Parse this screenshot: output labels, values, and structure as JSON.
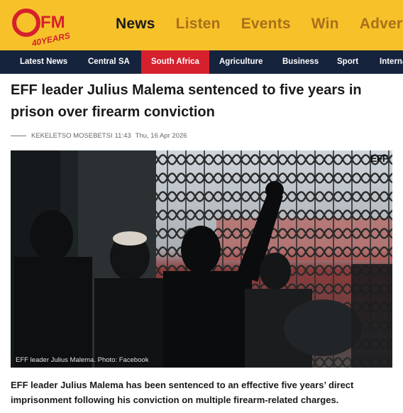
{
  "brand": {
    "logo_text": "OFM",
    "logo_tag": "40YEARS",
    "colors": {
      "header": "#f7c12a",
      "nav_bar": "#16233d",
      "active_category": "#d6202e",
      "nav_inactive": "#a8701a"
    }
  },
  "main_nav": {
    "items": [
      {
        "label": "News",
        "active": true
      },
      {
        "label": "Listen",
        "active": false
      },
      {
        "label": "Events",
        "active": false
      },
      {
        "label": "Win",
        "active": false
      },
      {
        "label": "Advertise",
        "active": false
      }
    ]
  },
  "categories": {
    "items": [
      {
        "label": "Latest News",
        "active": false
      },
      {
        "label": "Central SA",
        "active": false
      },
      {
        "label": "South Africa",
        "active": true
      },
      {
        "label": "Agriculture",
        "active": false
      },
      {
        "label": "Business",
        "active": false
      },
      {
        "label": "Sport",
        "active": false
      },
      {
        "label": "International",
        "active": false
      }
    ]
  },
  "article": {
    "headline": "EFF leader Julius Malema sentenced to five years in prison over firearm conviction",
    "author": "KEKELETSO MOSEBETSI",
    "time": "11:43",
    "date": "Thu, 16 Apr 2026",
    "image_caption": "EFF leader Julius Malema. Photo: Facebook",
    "image_logo": "EFF",
    "lede": "EFF leader Julius Malema has been sentenced to an effective five years’ direct imprisonment following his conviction on multiple firearm-related charges."
  }
}
